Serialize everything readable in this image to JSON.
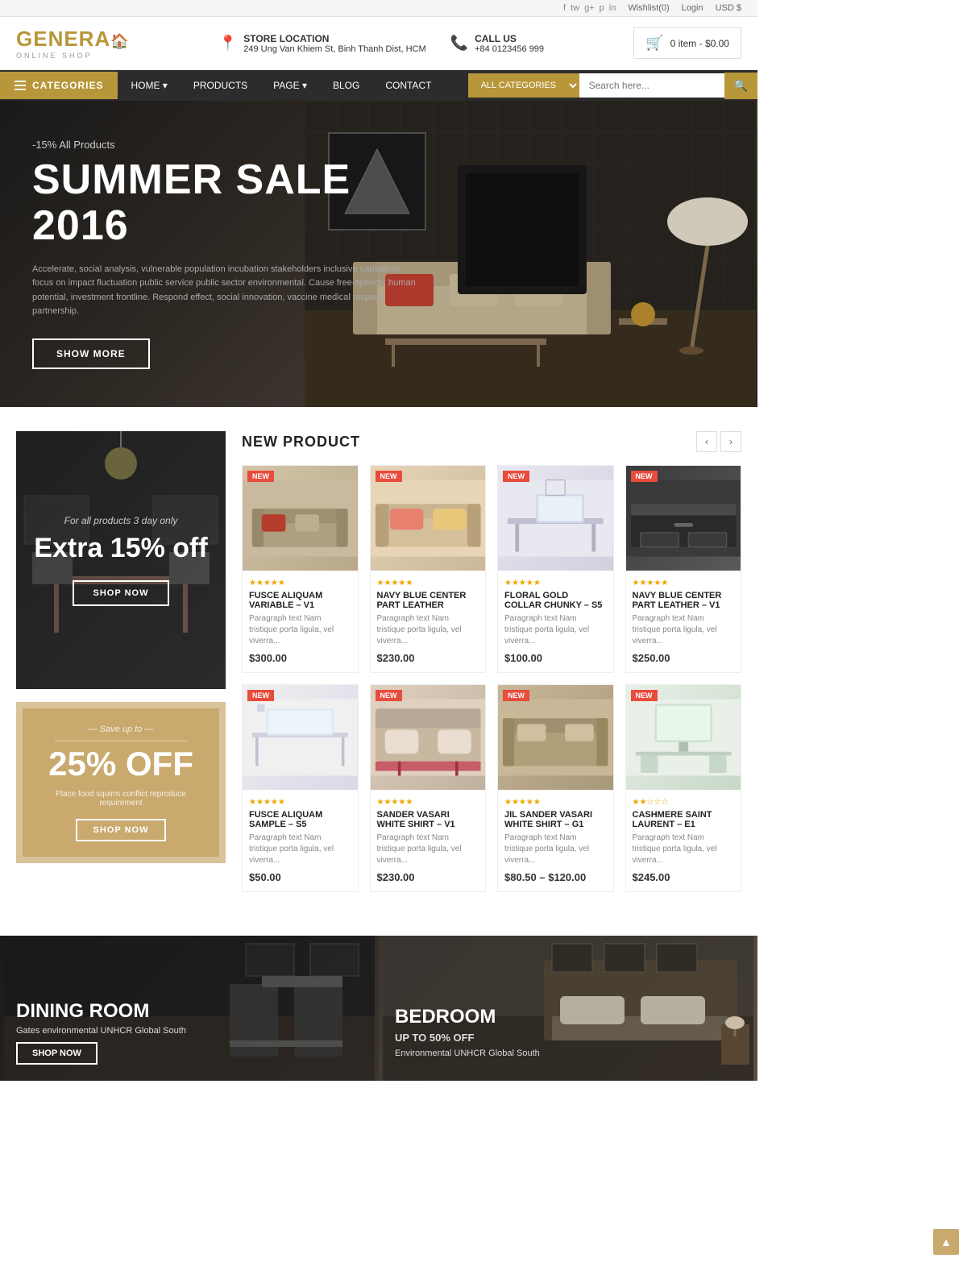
{
  "site": {
    "name": "GENERA",
    "name_sub": "ONLINE SHOP",
    "logo_letter": "A"
  },
  "topbar": {
    "wishlist": "Wishlist(0)",
    "login": "Login",
    "currency": "USD $"
  },
  "social": [
    "f",
    "tw",
    "g+",
    "p",
    "in"
  ],
  "header": {
    "store_label": "STORE LOCATION",
    "store_address": "249 Ung Van Khiem St, Binh Thanh Dist, HCM",
    "call_label": "CALL US",
    "call_number": "+84 0123456 999",
    "cart_label": "0 item - $0.00"
  },
  "nav": {
    "categories": "CATEGORIES",
    "links": [
      {
        "label": "HOME",
        "has_arrow": true
      },
      {
        "label": "PRODUCTS"
      },
      {
        "label": "PAGE",
        "has_arrow": true
      },
      {
        "label": "BLOG"
      },
      {
        "label": "CONTACT"
      }
    ],
    "search_placeholder": "Search here...",
    "search_cat": "ALL CATEGORIES"
  },
  "hero": {
    "tag": "-15% All Products",
    "title": "SUMMER SALE 2016",
    "desc": "Accelerate, social analysis, vulnerable population incubation stakeholders inclusive capitalism focus on impact fluctuation public service public sector environmental. Cause free-speech; human potential, investment frontline. Respond effect, social innovation, vaccine medical respect partnership.",
    "btn": "SHOW MORE"
  },
  "promo1": {
    "sub": "For all products 3 day only",
    "title": "Extra 15% off",
    "btn": "SHOP NOW"
  },
  "promo2": {
    "save": "— Save up to —",
    "title": "25% OFF",
    "desc": "Place food squirm conflict reproduce requirement",
    "btn": "SHOP NOW"
  },
  "new_product": {
    "title": "NEW PRODUCT",
    "nav_prev": "‹",
    "nav_next": "›",
    "products": [
      {
        "badge": "NEW",
        "stars": "★★★★★",
        "name": "FUSCE ALIQUAM VARIABLE – V1",
        "desc": "Paragraph text Nam tristique porta ligula, vel viverra...",
        "price": "$300.00",
        "color": "prod-sofa"
      },
      {
        "badge": "NEW",
        "stars": "★★★★★",
        "name": "NAVY BLUE CENTER PART LEATHER",
        "desc": "Paragraph text Nam tristique porta ligula, vel viverra...",
        "price": "$230.00",
        "color": "prod-sofa2"
      },
      {
        "badge": "NEW",
        "stars": "★★★★★",
        "name": "FLORAL GOLD COLLAR CHUNKY – S5",
        "desc": "Paragraph text Nam tristique porta ligula, vel viverra...",
        "price": "$100.00",
        "color": "prod-desk"
      },
      {
        "badge": "NEW",
        "stars": "★★★★★",
        "name": "NAVY BLUE CENTER PART LEATHER – V1",
        "desc": "Paragraph text Nam tristique porta ligula, vel viverra...",
        "price": "$250.00",
        "color": "prod-dark"
      },
      {
        "badge": "NEW",
        "stars": "★★★★★",
        "name": "FUSCE ALIQUAM SAMPLE – S5",
        "desc": "Paragraph text Nam tristique porta ligula, vel viverra...",
        "price": "$50.00",
        "color": "prod-desk2"
      },
      {
        "badge": "NEW",
        "stars": "★★★★★",
        "name": "SANDER VASARI WHITE SHIRT – V1",
        "desc": "Paragraph text Nam tristique porta ligula, vel viverra...",
        "price": "$230.00",
        "color": "prod-bed"
      },
      {
        "badge": "NEW",
        "stars": "★★★★★",
        "name": "JIL SANDER VASARI WHITE SHIRT – G1",
        "desc": "Paragraph text Nam tristique porta ligula, vel viverra...",
        "price": "$80.50 – $120.00",
        "color": "prod-sofa3"
      },
      {
        "badge": "NEW",
        "stars": "★★☆☆☆",
        "name": "CASHMERE SAINT LAURENT – E1",
        "desc": "Paragraph text Nam tristique porta ligula, vel viverra...",
        "price": "$245.00",
        "color": "prod-office"
      }
    ]
  },
  "bottom_banners": [
    {
      "title": "DINING ROOM",
      "subtitle": "Gates environmental UNHCR Global South",
      "btn": "SHOP NOW",
      "type": "dining"
    },
    {
      "title": "BEDROOM",
      "discount": "UP TO 50% OFF",
      "subtitle": "Environmental UNHCR Global South",
      "type": "bedroom"
    }
  ],
  "scroll_top": "▲"
}
